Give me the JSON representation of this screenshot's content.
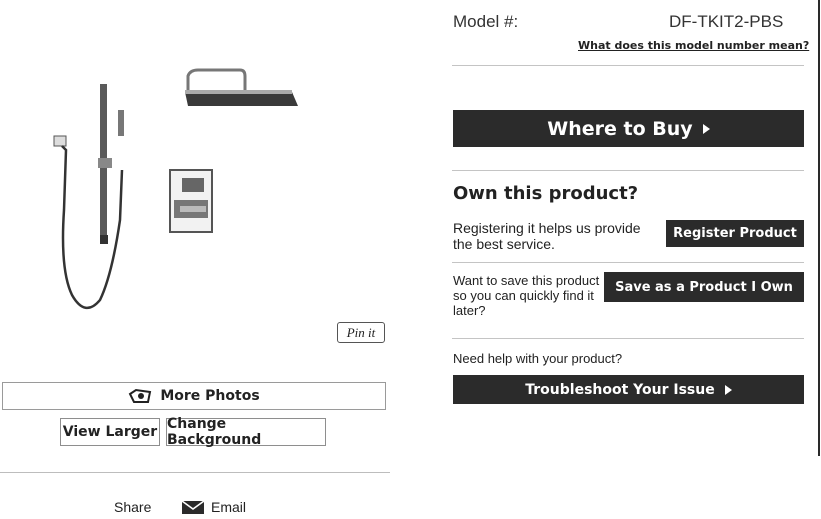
{
  "left": {
    "pinit_label": "Pin it",
    "more_photos_label": "More Photos",
    "view_larger_label": "View Larger",
    "change_background_label": "Change Background",
    "share_label": "Share",
    "email_label": "Email"
  },
  "right": {
    "model_label": "Model #:",
    "model_number": "DF-TKIT2-PBS",
    "model_link": "What does this model number mean?",
    "where_to_buy_label": "Where to Buy",
    "own_title": "Own this product?",
    "register_text": "Registering it helps us provide the best service.",
    "register_button": "Register Product",
    "save_text": "Want to save this product so you can quickly find it later?",
    "save_button": "Save as a Product I Own",
    "help_text": "Need help with your product?",
    "troubleshoot_button": "Troubleshoot Your Issue"
  },
  "icons": {
    "more_photos": "camera-icon",
    "email": "envelope-icon",
    "arrow": "play-arrow-icon"
  },
  "colors": {
    "dark_button": "#2b2b2b",
    "button_text": "#ffffff"
  }
}
